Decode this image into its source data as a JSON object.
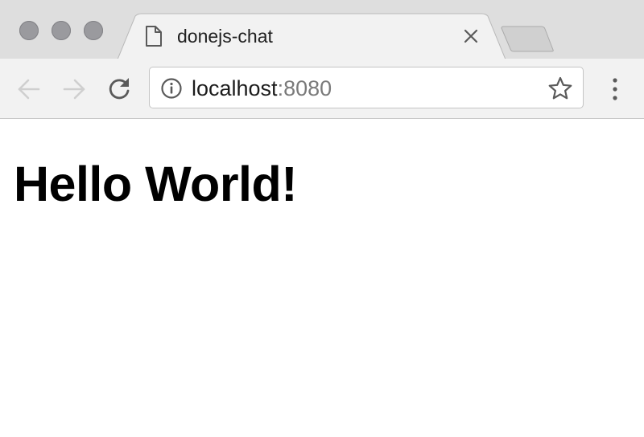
{
  "window": {
    "traffic_lights": [
      "close",
      "minimize",
      "maximize"
    ]
  },
  "tab": {
    "title": "donejs-chat",
    "icon": "document-icon",
    "close_icon": "close-icon"
  },
  "new_tab": {
    "icon": "new-tab-icon"
  },
  "toolbar": {
    "back_icon": "arrow-left-icon",
    "forward_icon": "arrow-right-icon",
    "reload_icon": "reload-icon",
    "menu_icon": "vertical-dots-icon"
  },
  "address_bar": {
    "host": "localhost",
    "port": ":8080",
    "info_icon": "info-icon",
    "bookmark_icon": "star-icon"
  },
  "page": {
    "heading": "Hello World!"
  },
  "colors": {
    "tabstrip_bg": "#dedede",
    "toolbar_bg": "#f2f2f2",
    "traffic_light": "#9a9a9e",
    "port_text": "#7a7a7a"
  }
}
